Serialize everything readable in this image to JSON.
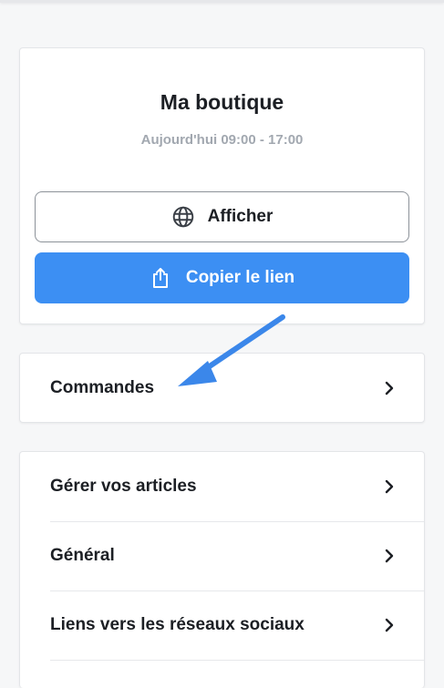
{
  "shop": {
    "title": "Ma boutique",
    "hours": "Aujourd'hui 09:00 - 17:00",
    "view_button": "Afficher",
    "view_icon": "globe-icon",
    "copy_button": "Copier le lien",
    "copy_icon": "share-icon"
  },
  "orders": {
    "label": "Commandes"
  },
  "settings": {
    "items": [
      {
        "label": "Gérer vos articles"
      },
      {
        "label": "Général"
      },
      {
        "label": "Liens vers les réseaux sociaux"
      }
    ]
  },
  "colors": {
    "primary": "#3c8ff3",
    "annotation_arrow": "#3b87ea",
    "muted_text": "#a2a8b0"
  }
}
